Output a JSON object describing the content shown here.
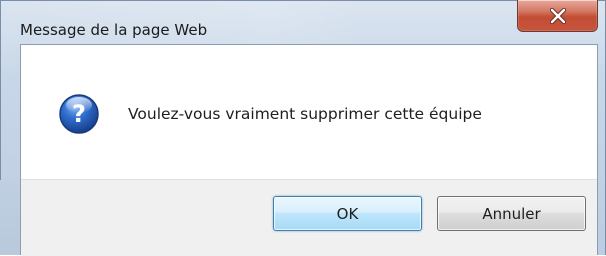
{
  "window": {
    "title": "Message de la page Web",
    "close_icon": "close-icon"
  },
  "dialog": {
    "icon": "question-icon",
    "message": "Voulez-vous vraiment supprimer cette équipe"
  },
  "buttons": {
    "ok_label": "OK",
    "cancel_label": "Annuler"
  },
  "colors": {
    "close_button": "#c24d34",
    "ok_border": "#3c7fb1",
    "question_icon": "#1f5fb8",
    "footer_bg": "#f0f0f0"
  }
}
